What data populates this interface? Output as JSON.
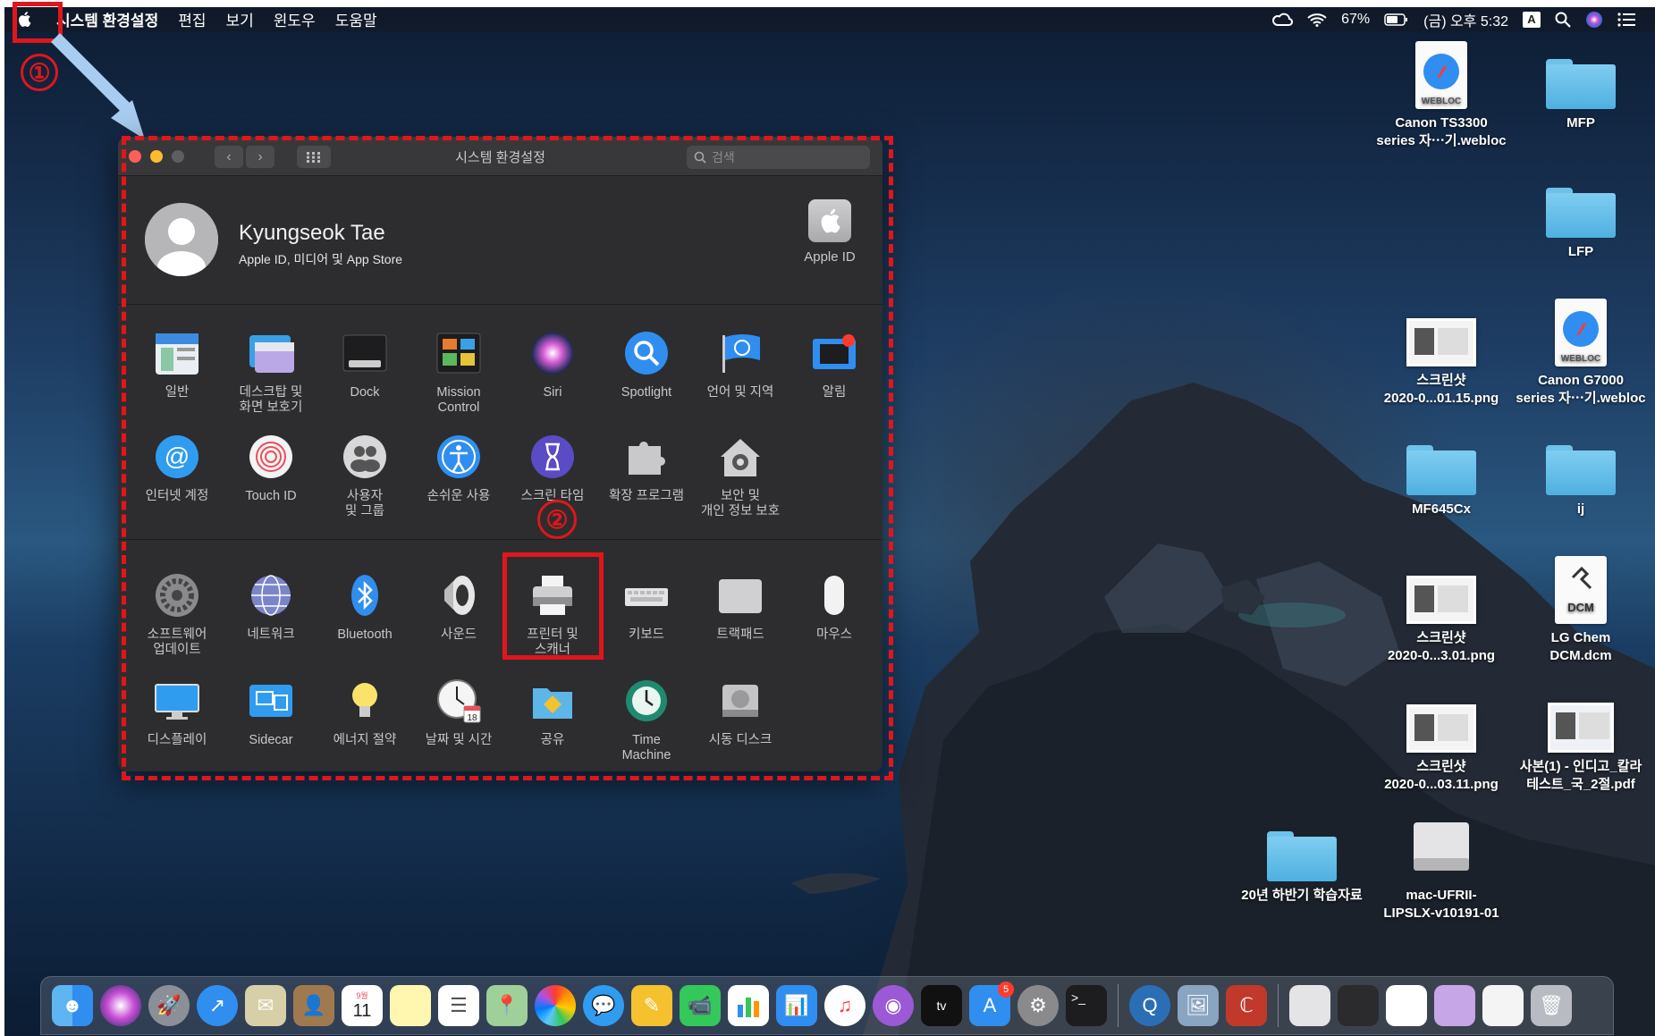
{
  "menubar": {
    "app_name": "시스템 환경설정",
    "items": [
      "편집",
      "보기",
      "윈도우",
      "도움말"
    ],
    "battery": "67%",
    "clock": "(금) 오후 5:32",
    "input_source": "A"
  },
  "annotations": {
    "step1": "①",
    "step2": "②"
  },
  "window": {
    "title": "시스템 환경설정",
    "search_placeholder": "검색",
    "user": {
      "name": "Kyungseok Tae",
      "subtitle": "Apple ID, 미디어 및 App Store"
    },
    "apple_id_label": "Apple ID",
    "row1": [
      "일반",
      "데스크탑 및\n화면 보호기",
      "Dock",
      "Mission\nControl",
      "Siri",
      "Spotlight",
      "언어 및 지역",
      "알림"
    ],
    "row2": [
      "인터넷 계정",
      "Touch ID",
      "사용자\n및 그룹",
      "손쉬운 사용",
      "스크린 타임",
      "확장 프로그램",
      "보안 및\n개인 정보 보호"
    ],
    "row3": [
      "소프트웨어\n업데이트",
      "네트워크",
      "Bluetooth",
      "사운드",
      "프린터 및\n스캐너",
      "키보드",
      "트랙패드",
      "마우스"
    ],
    "row4": [
      "디스플레이",
      "Sidecar",
      "에너지 절약",
      "날짜 및 시간",
      "공유",
      "Time\nMachine",
      "시동 디스크"
    ]
  },
  "desktop": [
    "Canon TS3300\nseries 자⋯기.webloc",
    "MFP",
    "LFP",
    "스크린샷\n2020-0...01.15.png",
    "Canon G7000\nseries 자⋯기.webloc",
    "MF645Cx",
    "ij",
    "스크린샷\n2020-0...3.01.png",
    "LG Chem\nDCM.dcm",
    "스크린샷\n2020-0...03.11.png",
    "사본(1) - 인디고_칼라\n테스트_국_2절.pdf",
    "20년 하반기 학습자료",
    "mac-UFRII-\nLIPSLX-v10191-01"
  ],
  "webloc_badge": "WEBLOC",
  "dcm_badge": "DCM",
  "dock": {
    "calendar_month": "9월",
    "calendar_day": "11",
    "appstore_badge": "5",
    "tv_label": "tv",
    "clock_day": "18"
  }
}
